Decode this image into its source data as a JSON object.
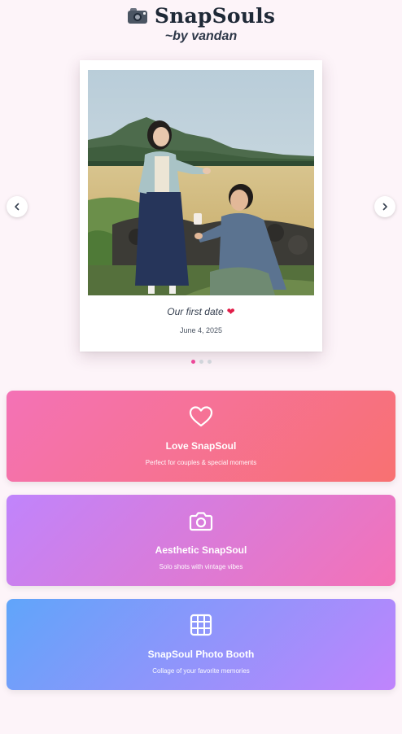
{
  "header": {
    "title": "SnapSouls",
    "subtitle": "~by vandan",
    "logo_icon": "camera-emoji"
  },
  "carousel": {
    "caption": "Our first date",
    "caption_emoji": "❤",
    "date": "June 4, 2025",
    "slide_count": 3,
    "active_slide": 1,
    "prev_icon": "chevron-left-icon",
    "next_icon": "chevron-right-icon"
  },
  "cards": [
    {
      "title": "Love SnapSoul",
      "description": "Perfect for couples & special moments",
      "icon": "heart-icon"
    },
    {
      "title": "Aesthetic SnapSoul",
      "description": "Solo shots with vintage vibes",
      "icon": "camera-icon"
    },
    {
      "title": "SnapSoul Photo Booth",
      "description": "Collage of your favorite memories",
      "icon": "grid-icon"
    }
  ],
  "colors": {
    "background": "#fdf4f9",
    "active_dot": "#ec4899",
    "love_gradient": [
      "#f472b6",
      "#f87171"
    ],
    "aesthetic_gradient": [
      "#c084fc",
      "#f472b6"
    ],
    "booth_gradient": [
      "#60a5fa",
      "#c084fc"
    ]
  }
}
